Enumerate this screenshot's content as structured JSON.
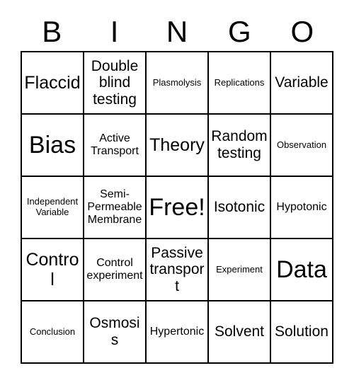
{
  "card": {
    "title": "BINGO",
    "header_letters": [
      "B",
      "I",
      "N",
      "G",
      "O"
    ],
    "columns": 5,
    "rows": 5,
    "colors": {
      "background": "#ffffff",
      "text": "#000000",
      "border": "#000000"
    },
    "free_space": {
      "label": "Free!",
      "row": 3,
      "column": 3
    },
    "cells": [
      [
        {
          "label": "Flaccid",
          "size": "lg"
        },
        {
          "label": "Double blind testing",
          "size": "md"
        },
        {
          "label": "Plasmolysis",
          "size": "xs"
        },
        {
          "label": "Replications",
          "size": "xs"
        },
        {
          "label": "Variable",
          "size": "md"
        }
      ],
      [
        {
          "label": "Bias",
          "size": "xl"
        },
        {
          "label": "Active Transport",
          "size": "sm"
        },
        {
          "label": "Theory",
          "size": "lg"
        },
        {
          "label": "Random testing",
          "size": "md"
        },
        {
          "label": "Observation",
          "size": "xs"
        }
      ],
      [
        {
          "label": "Independent Variable",
          "size": "xs"
        },
        {
          "label": "Semi-Permeable Membrane",
          "size": "sm"
        },
        {
          "label": "Free!",
          "size": "xl"
        },
        {
          "label": "Isotonic",
          "size": "md"
        },
        {
          "label": "Hypotonic",
          "size": "sm"
        }
      ],
      [
        {
          "label": "Control",
          "size": "lg"
        },
        {
          "label": "Control experiment",
          "size": "sm"
        },
        {
          "label": "Passive transport",
          "size": "md"
        },
        {
          "label": "Experiment",
          "size": "xs"
        },
        {
          "label": "Data",
          "size": "xl"
        }
      ],
      [
        {
          "label": "Conclusion",
          "size": "xs"
        },
        {
          "label": "Osmosis",
          "size": "md"
        },
        {
          "label": "Hypertonic",
          "size": "sm"
        },
        {
          "label": "Solvent",
          "size": "md"
        },
        {
          "label": "Solution",
          "size": "md"
        }
      ]
    ]
  }
}
